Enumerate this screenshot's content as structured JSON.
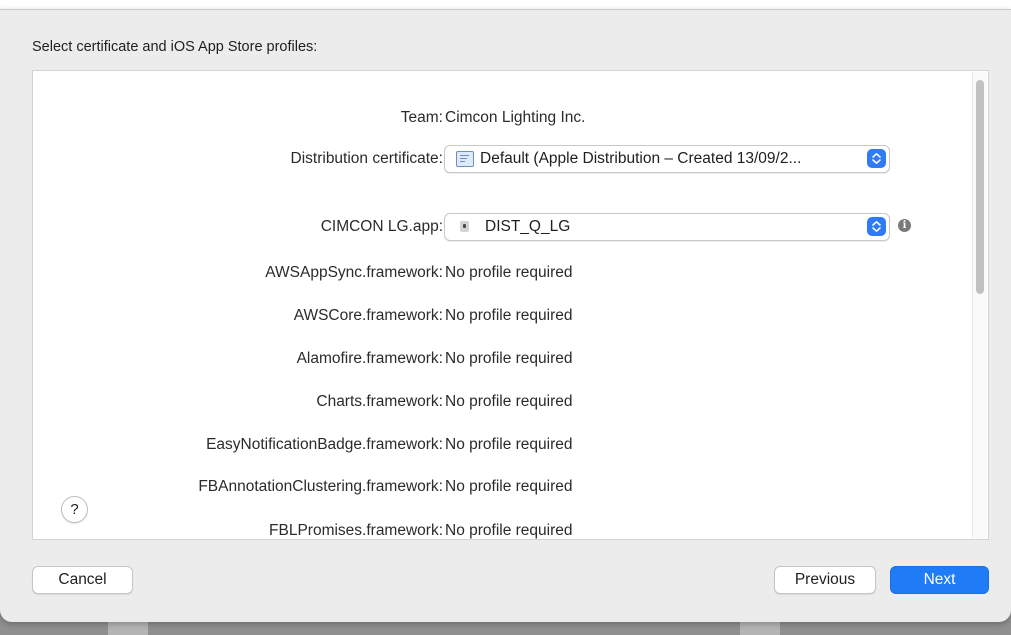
{
  "dialog": {
    "heading": "Select certificate and iOS App Store profiles:"
  },
  "team": {
    "label": "Team:",
    "value": "Cimcon Lighting Inc."
  },
  "distribution_certificate": {
    "label": "Distribution certificate:",
    "selected": "Default (Apple Distribution – Created 13/09/2..."
  },
  "app_profile": {
    "label": "CIMCON LG.app:",
    "selected": "DIST_Q_LG",
    "info_icon": "info-icon"
  },
  "frameworks": [
    {
      "label": "AWSAppSync.framework:",
      "value": "No profile required"
    },
    {
      "label": "AWSCore.framework:",
      "value": "No profile required"
    },
    {
      "label": "Alamofire.framework:",
      "value": "No profile required"
    },
    {
      "label": "Charts.framework:",
      "value": "No profile required"
    },
    {
      "label": "EasyNotificationBadge.framework:",
      "value": "No profile required"
    },
    {
      "label": "FBAnnotationClustering.framework:",
      "value": "No profile required"
    },
    {
      "label": "FBLPromises.framework:",
      "value": "No profile required"
    }
  ],
  "buttons": {
    "help": "?",
    "cancel": "Cancel",
    "previous": "Previous",
    "next": "Next"
  },
  "colors": {
    "accent": "#1f7bf6",
    "sheet_background": "#ececec",
    "panel_background": "#ffffff"
  }
}
